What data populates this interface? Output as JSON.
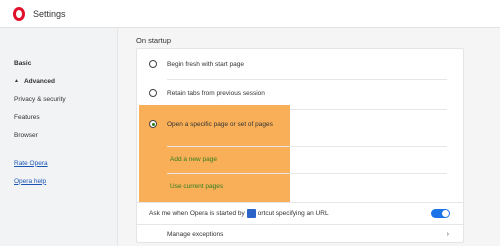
{
  "app": {
    "title": "Settings",
    "logo_icon": "opera-logo-icon"
  },
  "sidebar": {
    "items": [
      {
        "label": "Basic"
      },
      {
        "label": "Advanced"
      },
      {
        "label": "Privacy & security"
      },
      {
        "label": "Features"
      },
      {
        "label": "Browser"
      }
    ],
    "links": [
      {
        "label": "Rate Opera"
      },
      {
        "label": "Opera help"
      }
    ]
  },
  "main": {
    "section_title": "On startup",
    "options": [
      {
        "label": "Begin fresh with start page",
        "selected": false
      },
      {
        "label": "Retain tabs from previous session",
        "selected": false
      },
      {
        "label": "Open a specific page or set of pages",
        "selected": true
      }
    ],
    "add_page_label": "Add a new page",
    "use_current_label": "Use current pages",
    "ask_text_prefix": "Ask me when Opera is started by",
    "ask_text_suffix": "ortcut specifying an URL",
    "ask_toggle_on": true,
    "manage_exceptions_label": "Manage exceptions",
    "chevron": "›"
  },
  "colors": {
    "highlight": "#f7a84a",
    "toggle": "#1a73e8",
    "link_green": "#2e7d1e",
    "brand_red": "#e0102a"
  }
}
